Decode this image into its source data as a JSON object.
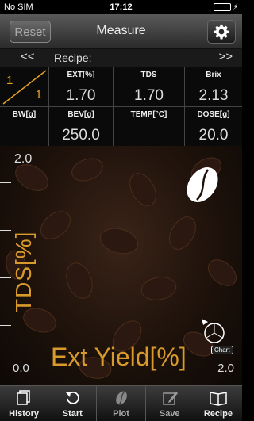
{
  "status": {
    "carrier": "No SIM",
    "time": "17:12"
  },
  "nav": {
    "title": "Measure",
    "reset_label": "Reset"
  },
  "recipe": {
    "prev": "<<",
    "label": "Recipe:",
    "next": ">>"
  },
  "ratio": {
    "top": "1",
    "bottom": "1"
  },
  "fields": [
    {
      "label": "EXT[%]",
      "value": "1.70"
    },
    {
      "label": "TDS",
      "value": "1.70"
    },
    {
      "label": "Brix",
      "value": "2.13"
    },
    {
      "label": "BW[g]",
      "value": ""
    },
    {
      "label": "BEV[g]",
      "value": "250.0"
    },
    {
      "label": "TEMP[°C]",
      "value": ""
    },
    {
      "label": "DOSE[g]",
      "value": "20.0"
    }
  ],
  "plot": {
    "y_max": "2.0",
    "x_min": "0.0",
    "x_max": "2.0",
    "y_label": "TDS[%]",
    "x_label": "Ext Yield[%]",
    "chart_tag": "Chart"
  },
  "tabs": [
    {
      "label": "History",
      "icon": "history-icon"
    },
    {
      "label": "Start",
      "icon": "start-icon"
    },
    {
      "label": "Plot",
      "icon": "plot-icon"
    },
    {
      "label": "Save",
      "icon": "save-icon"
    },
    {
      "label": "Recipe",
      "icon": "recipe-book-icon"
    }
  ],
  "colors": {
    "accent": "#d89a2a",
    "ratio": "#e8a020",
    "battery": "#6ee06e"
  }
}
